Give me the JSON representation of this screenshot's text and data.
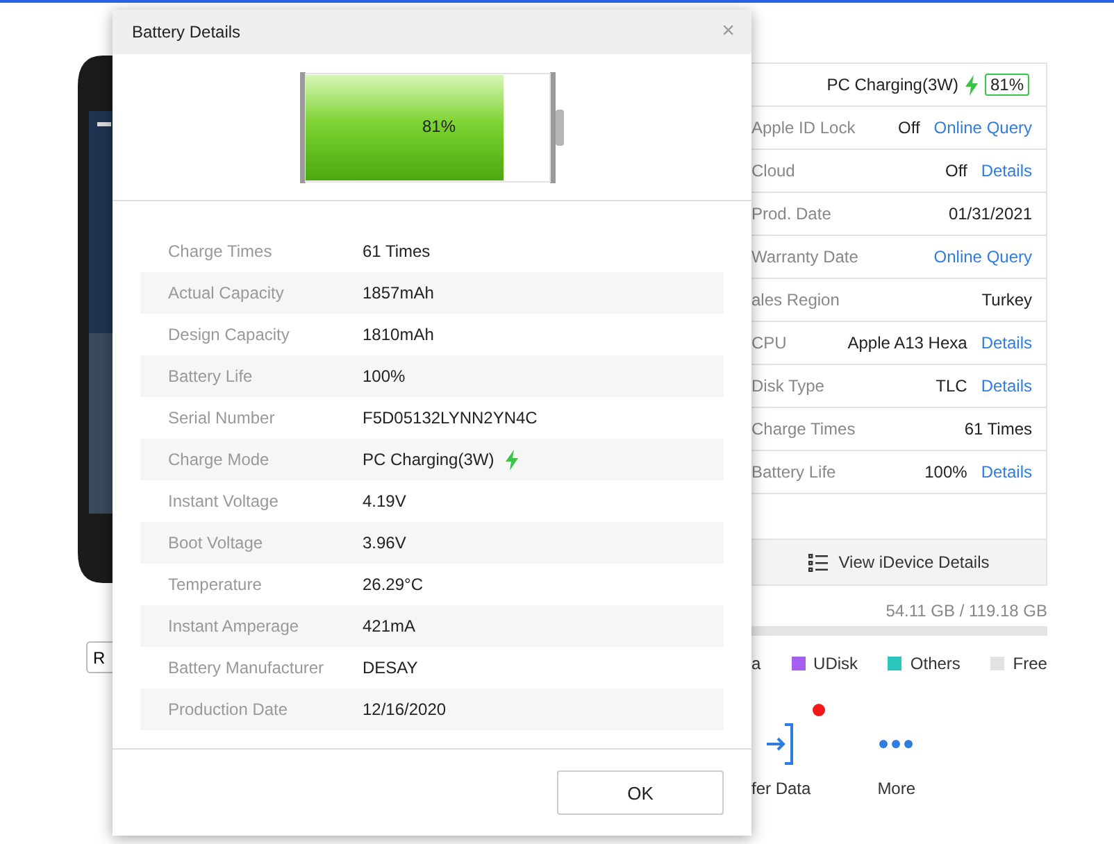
{
  "dialog": {
    "title": "Battery Details",
    "close": "×",
    "battery": {
      "level": 0.81,
      "reading": "81%"
    },
    "rows": [
      {
        "label": "Charge Times",
        "value": "61 Times",
        "charging": false
      },
      {
        "label": "Actual Capacity",
        "value": "1857mAh",
        "charging": false
      },
      {
        "label": "Design Capacity",
        "value": "1810mAh",
        "charging": false
      },
      {
        "label": "Battery Life",
        "value": "100%",
        "charging": false
      },
      {
        "label": "Serial Number",
        "value": "F5D05132LYNN2YN4C",
        "charging": false
      },
      {
        "label": "Charge Mode",
        "value": "PC Charging(3W)",
        "charging": true
      },
      {
        "label": "Instant Voltage",
        "value": "4.19V",
        "charging": false
      },
      {
        "label": "Boot Voltage",
        "value": "3.96V",
        "charging": false
      },
      {
        "label": "Temperature",
        "value": "26.29°C",
        "charging": false
      },
      {
        "label": "Instant Amperage",
        "value": "421mA",
        "charging": false
      },
      {
        "label": "Battery Manufacturer",
        "value": "DESAY",
        "charging": false
      },
      {
        "label": "Production Date",
        "value": "12/16/2020",
        "charging": false
      }
    ],
    "ok": "OK"
  },
  "phone_panel": {
    "button": "R"
  },
  "device_info": {
    "charge_status": "PC Charging(3W)",
    "battery_badge": "81%",
    "rows": [
      {
        "label": "Apple ID Lock",
        "value": "Off",
        "link": "Online Query"
      },
      {
        "label": "Cloud",
        "value": "Off",
        "link": "Details"
      },
      {
        "label": "Prod. Date",
        "value": "01/31/2021"
      },
      {
        "label": "Warranty Date",
        "link": "Online Query"
      },
      {
        "label": "ales Region",
        "value": "Turkey"
      },
      {
        "label": "CPU",
        "value": "Apple A13 Hexa",
        "link": "Details"
      },
      {
        "label": "Disk Type",
        "value": "TLC",
        "link": "Details"
      },
      {
        "label": "Charge Times",
        "value": "61 Times"
      },
      {
        "label": "Battery Life",
        "value": "100%",
        "link": "Details"
      }
    ],
    "details_button": "View iDevice Details"
  },
  "storage": {
    "usage": "54.11 GB / 119.18 GB",
    "legend": [
      {
        "label": "a"
      },
      {
        "label": "UDisk",
        "color": "#a45ef0"
      },
      {
        "label": "Others",
        "color": "#2dc6bf"
      },
      {
        "label": "Free",
        "color": "#e2e2e2"
      }
    ]
  },
  "actions": [
    {
      "label": "fer Data",
      "kind": "transfer",
      "badge": true
    },
    {
      "label": "More",
      "kind": "more",
      "badge": false
    }
  ]
}
